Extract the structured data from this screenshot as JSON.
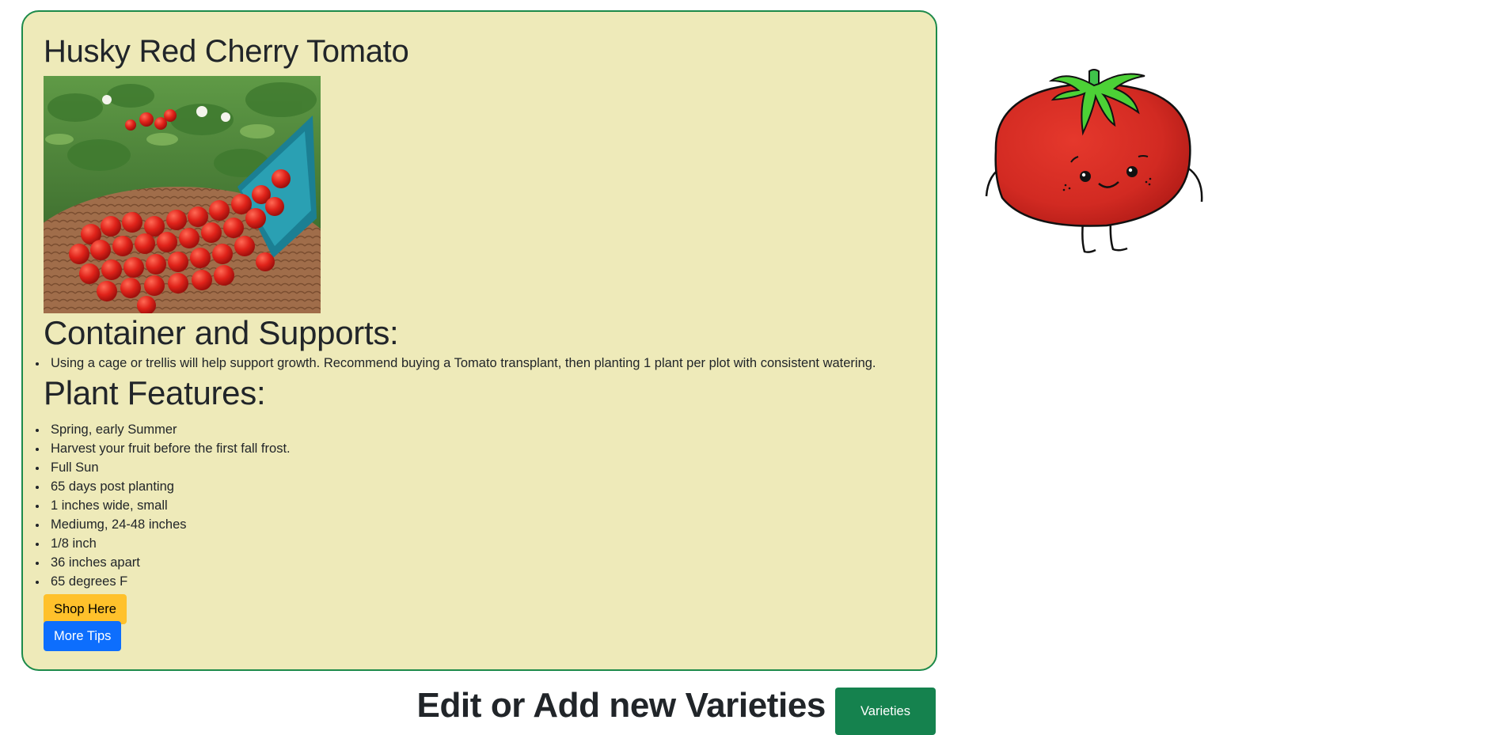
{
  "card": {
    "title": "Husky Red Cherry Tomato",
    "photo_alt": "cherry tomatoes spilling from a blue colander onto a woven tray",
    "container_heading": "Container and Supports:",
    "container_items": [
      "Using a cage or trellis will help support growth. Recommend buying a Tomato transplant, then planting 1 plant per plot with consistent watering."
    ],
    "features_heading": "Plant Features:",
    "features_items": [
      "Spring, early Summer",
      "Harvest your fruit before the first fall frost.",
      "Full Sun",
      "65 days post planting",
      "1 inches wide, small",
      "Mediumg, 24-48 inches",
      "1/8 inch",
      "36 inches apart",
      "65 degrees F"
    ],
    "shop_button": "Shop Here",
    "tips_button": "More Tips"
  },
  "footer": {
    "title": "Edit or Add new Varieties",
    "varieties_button": "Varieties"
  },
  "colors": {
    "card_bg": "#eeeab9",
    "card_border": "#1c8a4a",
    "shop_button": "#ffc12b",
    "tips_button": "#0d6efd",
    "varieties_button": "#15824e"
  },
  "mascot_icon": "tomato-mascot-icon"
}
